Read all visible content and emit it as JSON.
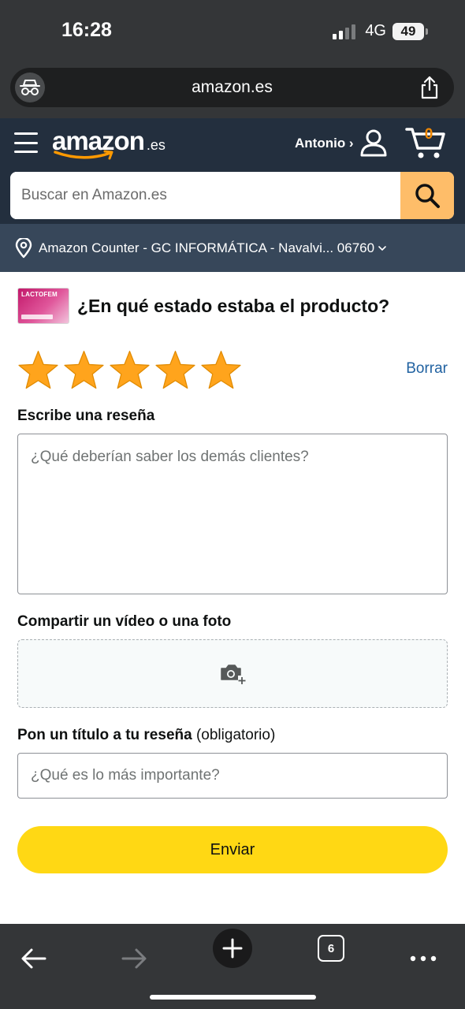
{
  "status_bar": {
    "time": "16:28",
    "network": "4G",
    "battery": "49"
  },
  "browser": {
    "url": "amazon.es"
  },
  "header": {
    "logo_word": "amazon",
    "logo_tld": ".es",
    "account_label": "Antonio ›",
    "cart_count": "0"
  },
  "search": {
    "placeholder": "Buscar en Amazon.es"
  },
  "delivery": {
    "location_text": "Amazon Counter - GC INFORMÁTICA - Navalvi... 06760"
  },
  "product": {
    "thumb_label": "LACTOFEM"
  },
  "review": {
    "question": "¿En qué estado estaba el producto?",
    "rating": 5,
    "rating_max": 5,
    "clear_label": "Borrar",
    "write_review_label": "Escribe una reseña",
    "review_placeholder": "¿Qué deberían saber los demás clientes?",
    "media_label": "Compartir un vídeo o una foto",
    "title_label": "Pon un título a tu reseña",
    "title_label_optional": "(obligatorio)",
    "title_placeholder": "¿Qué es lo más importante?",
    "submit_label": "Enviar"
  },
  "toolbar": {
    "tab_count": "6"
  },
  "colors": {
    "header_bg": "#232f3e",
    "delivery_bg": "#37475a",
    "search_button": "#febd69",
    "star": "#ffa41c",
    "link": "#2162a1",
    "submit": "#ffd814"
  },
  "icons": {
    "privacy": "spy-icon",
    "share": "share-icon",
    "menu": "hamburger-icon",
    "user": "user-icon",
    "cart": "cart-icon",
    "search": "search-icon",
    "location": "location-pin-icon",
    "camera": "camera-add-icon",
    "back": "back-arrow-icon",
    "forward": "forward-arrow-icon",
    "new_tab": "plus-icon",
    "more": "more-icon"
  }
}
